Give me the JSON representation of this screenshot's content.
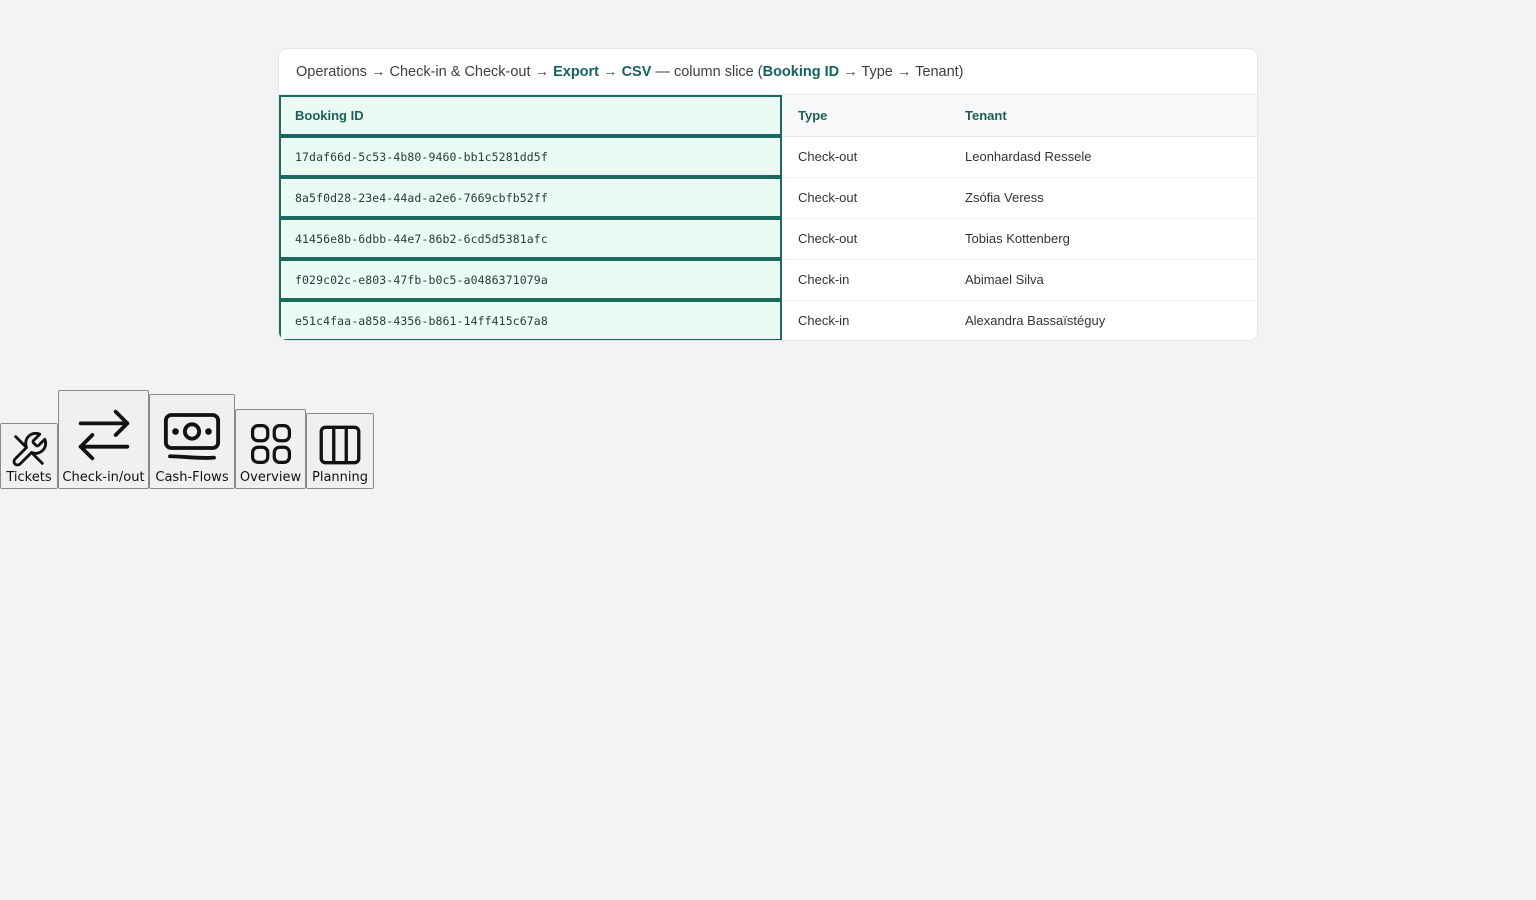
{
  "breadcrumb": {
    "operations": "Operations",
    "arrow1": " → ",
    "checkin": "Check-in & Check-out",
    "arrow2": " → ",
    "export": "Export → CSV",
    "slice_prefix": " — column slice (",
    "booking_id": "Booking ID",
    "slice_rest": " → Type → Tenant)"
  },
  "table": {
    "headers": {
      "booking_id": "Booking ID",
      "type": "Type",
      "tenant": "Tenant"
    },
    "rows": [
      {
        "booking_id": "17daf66d-5c53-4b80-9460-bb1c5281dd5f",
        "type": "Check-out",
        "tenant": "Leonhardasd Ressele"
      },
      {
        "booking_id": "8a5f0d28-23e4-44ad-a2e6-7669cbfb52ff",
        "type": "Check-out",
        "tenant": "Zsófia Veress"
      },
      {
        "booking_id": "41456e8b-6dbb-44e7-86b2-6cd5d5381afc",
        "type": "Check-out",
        "tenant": "Tobias Kottenberg"
      },
      {
        "booking_id": "f029c02c-e803-47fb-b0c5-a0486371079a",
        "type": "Check-in",
        "tenant": "Abimael Silva"
      },
      {
        "booking_id": "e51c4faa-a858-4356-b861-14ff415c67a8",
        "type": "Check-in",
        "tenant": "Alexandra Bassaïstéguy"
      }
    ]
  },
  "dock": {
    "items": [
      {
        "label": "Tickets",
        "icon": "tools-icon"
      },
      {
        "label": "Check-in/out",
        "icon": "swap-arrows-icon"
      },
      {
        "label": "Cash-Flows",
        "icon": "banknote-icon"
      },
      {
        "label": "Overview",
        "icon": "grid-icon"
      },
      {
        "label": "Planning",
        "icon": "columns-icon"
      }
    ]
  },
  "colors": {
    "accent": "#14635c",
    "highlight_bg": "#ebfbf3",
    "page_bg": "#f2f3f5"
  }
}
